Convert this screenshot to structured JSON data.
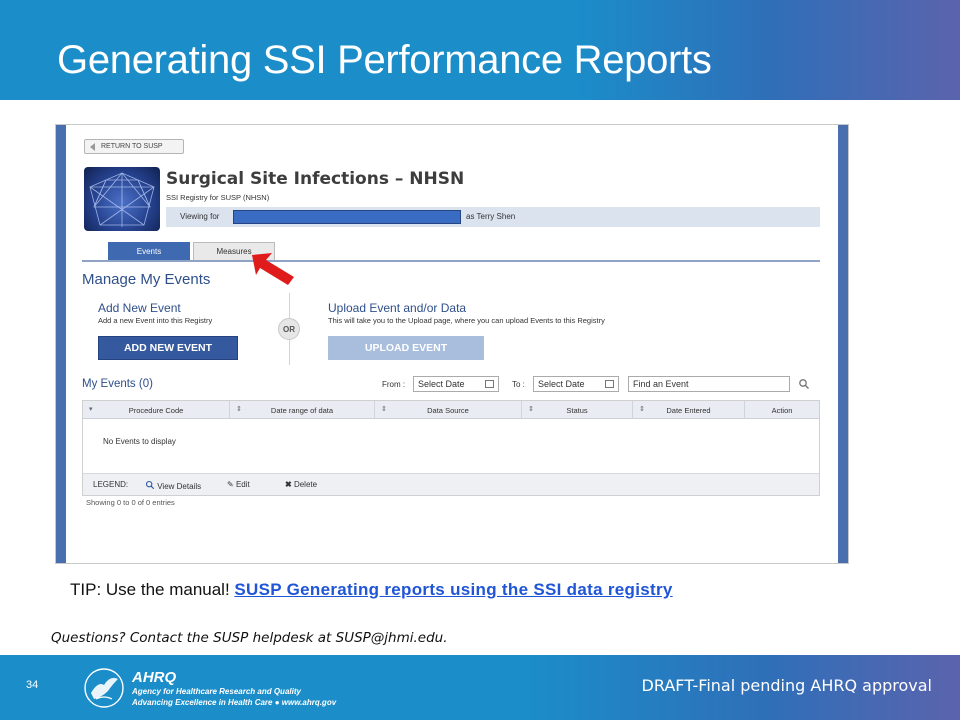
{
  "slide": {
    "title": "Generating SSI Performance Reports",
    "slide_number": "34",
    "tip_prefix": "TIP: Use the manual! ",
    "tip_link": "SUSP Generating reports using the SSI data registry",
    "questions": "Questions? Contact the SUSP helpdesk at SUSP@jhmi.edu.",
    "draft_notice": "DRAFT-Final pending AHRQ approval"
  },
  "footer_logo": {
    "wordmark": "AHRQ",
    "line1": "Agency for Healthcare Research and Quality",
    "line2": "Advancing Excellence in Health Care ● www.ahrq.gov"
  },
  "registry": {
    "return_button": "RETURN TO SUSP",
    "title": "Surgical Site Infections – NHSN",
    "subtitle": "SSI Registry for SUSP (NHSN)",
    "viewing_label": "Viewing for",
    "viewing_user": "as Terry Shen",
    "tabs": [
      {
        "label": "Events",
        "active": true
      },
      {
        "label": "Measures",
        "active": false
      }
    ],
    "manage_title": "Manage My Events",
    "add_section": {
      "title": "Add New Event",
      "description": "Add a new Event into this Registry",
      "button": "ADD NEW EVENT"
    },
    "or_label": "OR",
    "upload_section": {
      "title": "Upload Event and/or Data",
      "description": "This will take you to the Upload page, where you can upload Events to this Registry",
      "button": "UPLOAD EVENT"
    },
    "my_events": {
      "title": "My Events (0)",
      "from_label": "From :",
      "from_placeholder": "Select Date",
      "to_label": "To :",
      "to_placeholder": "Select Date",
      "find_placeholder": "Find an Event",
      "columns": [
        "Procedure Code",
        "Date range of data",
        "Data Source",
        "Status",
        "Date Entered",
        "Action"
      ],
      "empty_message": "No Events to display",
      "legend_label": "LEGEND:",
      "legend_items": [
        "View Details",
        "Edit",
        "Delete"
      ],
      "showing": "Showing 0 to 0 of 0 entries"
    }
  },
  "colors": {
    "header_blue": "#1b8dc9",
    "registry_blue": "#34599e",
    "link_blue": "#1f55d6",
    "arrow_red": "#e01b1b"
  }
}
